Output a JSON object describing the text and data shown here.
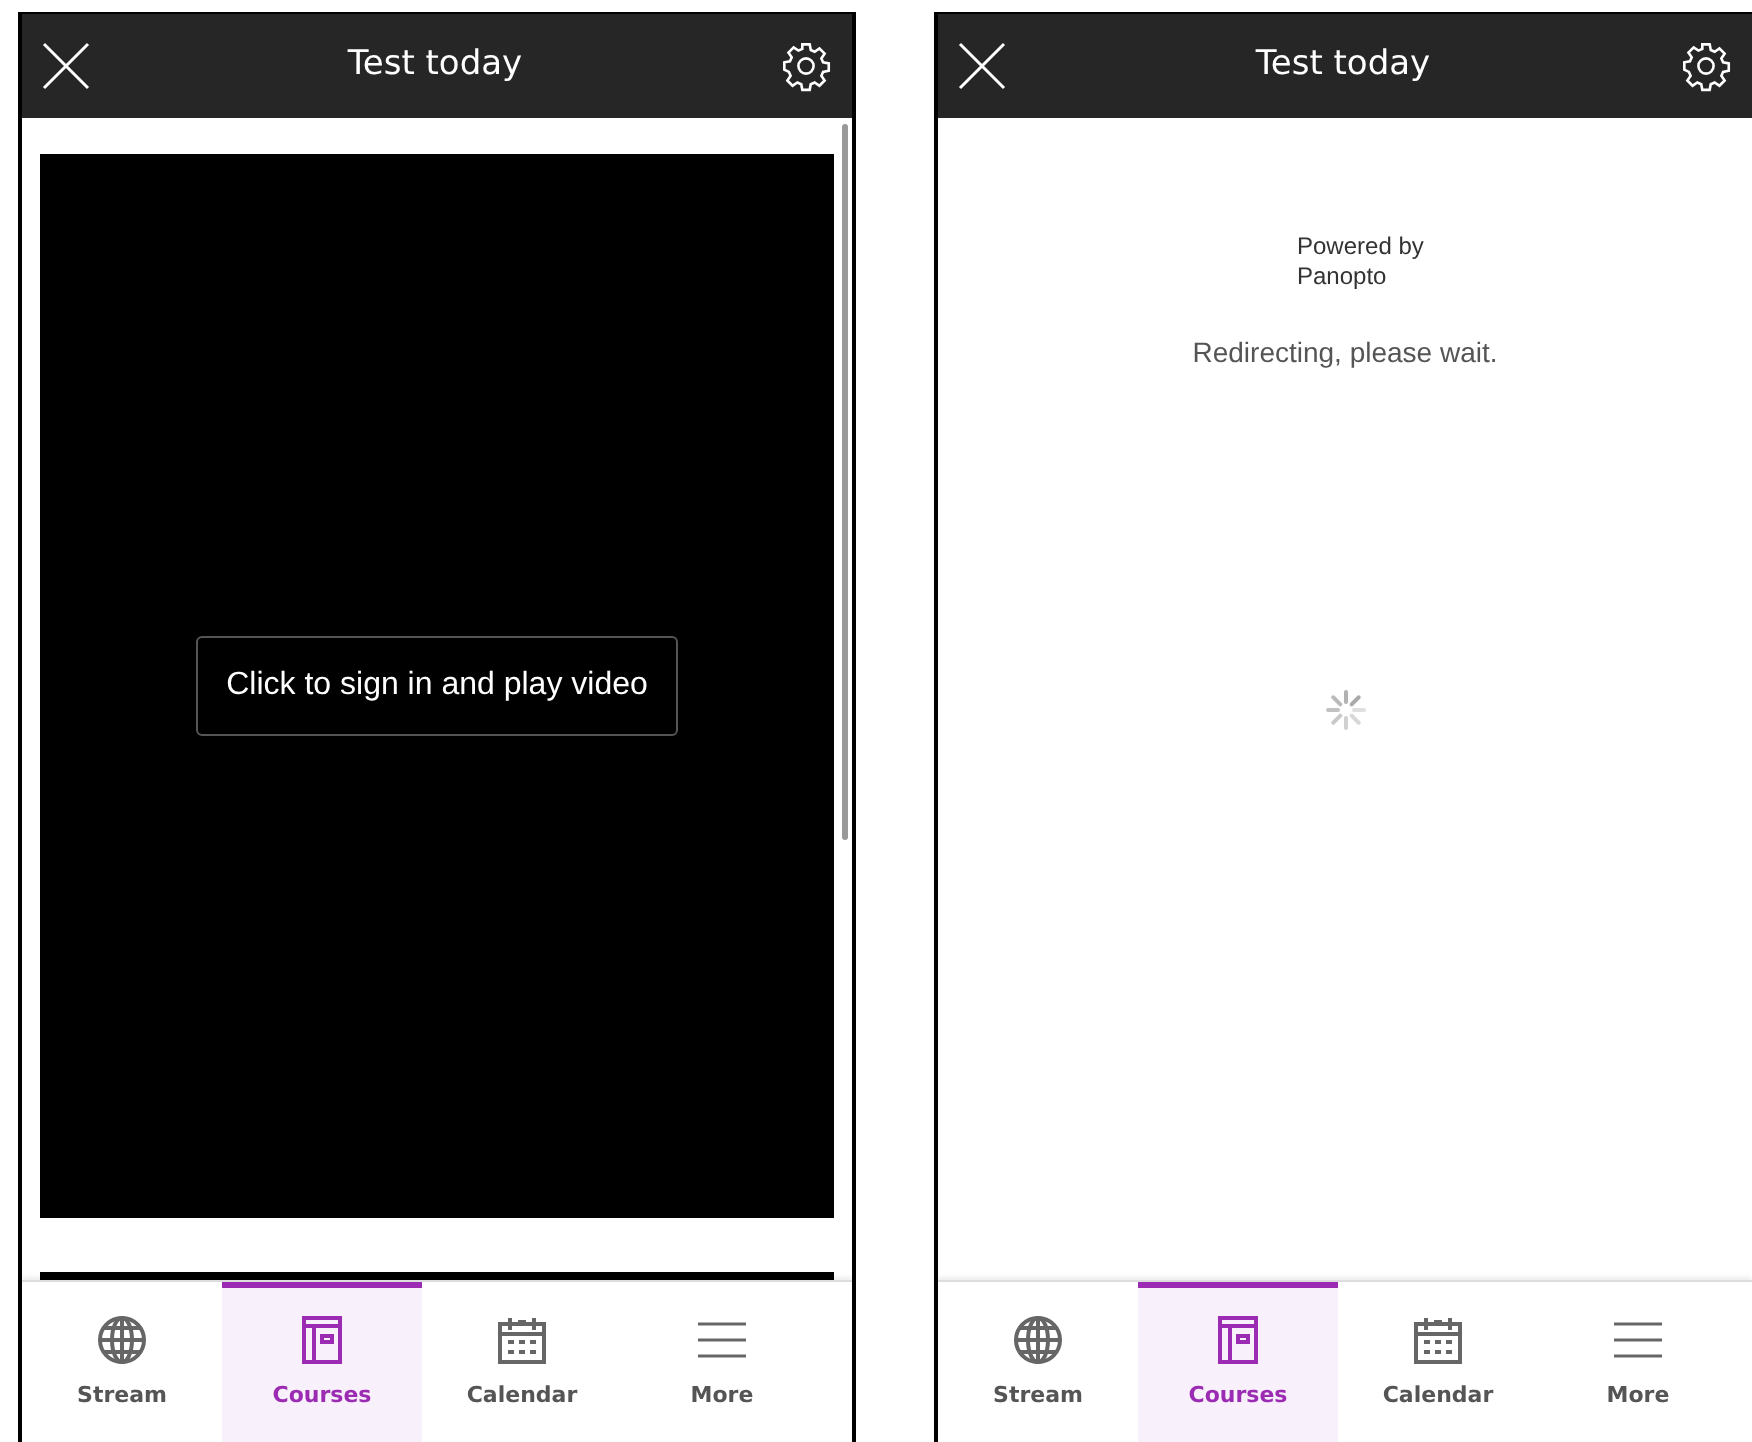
{
  "screens": [
    {
      "title": "Test today",
      "content": {
        "kind": "video",
        "button": "Click to sign in and play video"
      },
      "tabs": [
        {
          "label": "Stream",
          "kind": "globe",
          "selected": false
        },
        {
          "label": "Courses",
          "kind": "book",
          "selected": true
        },
        {
          "label": "Calendar",
          "kind": "calendar",
          "selected": false
        },
        {
          "label": "More",
          "kind": "menu",
          "selected": false
        }
      ]
    },
    {
      "title": "Test today",
      "content": {
        "kind": "redirect",
        "powered_by": [
          "Powered by",
          "Panopto"
        ],
        "message": "Redirecting, please wait."
      },
      "tabs": [
        {
          "label": "Stream",
          "kind": "globe",
          "selected": false
        },
        {
          "label": "Courses",
          "kind": "book",
          "selected": true
        },
        {
          "label": "Calendar",
          "kind": "calendar",
          "selected": false
        },
        {
          "label": "More",
          "kind": "menu",
          "selected": false
        }
      ]
    }
  ]
}
